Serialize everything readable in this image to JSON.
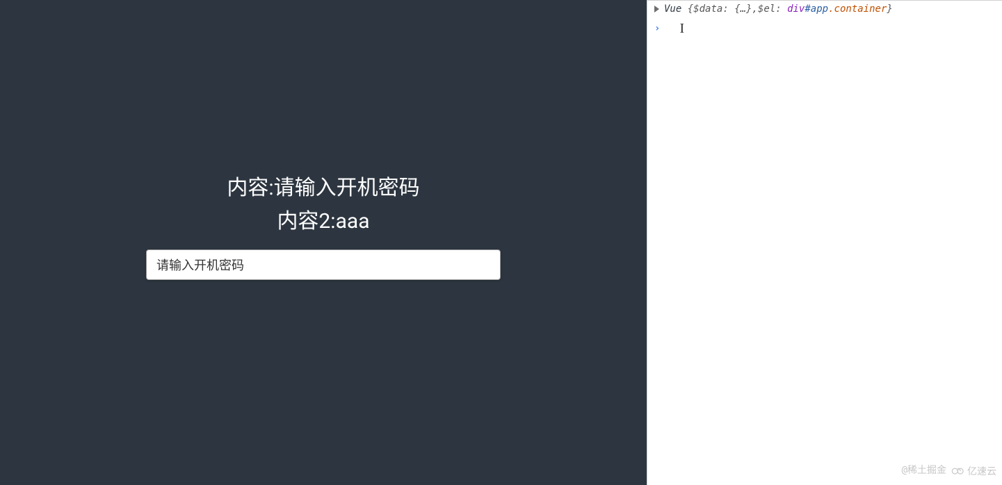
{
  "app": {
    "line1_label": "内容:",
    "line1_value": "请输入开机密码",
    "line2_label": "内容2:",
    "line2_value": "aaa",
    "input_value": "请输入开机密码"
  },
  "devtools": {
    "console": {
      "object_class": "Vue",
      "brace_open": "{",
      "prop1_key": "$data:",
      "prop1_val": "{…}",
      "sep": ", ",
      "prop2_key": "$el:",
      "el_tag": "div",
      "el_id": "#app",
      "el_class": ".container",
      "brace_close": "}"
    },
    "prompt_symbol": "›"
  },
  "watermarks": {
    "w1": "@稀土掘金",
    "w2": "亿速云"
  }
}
